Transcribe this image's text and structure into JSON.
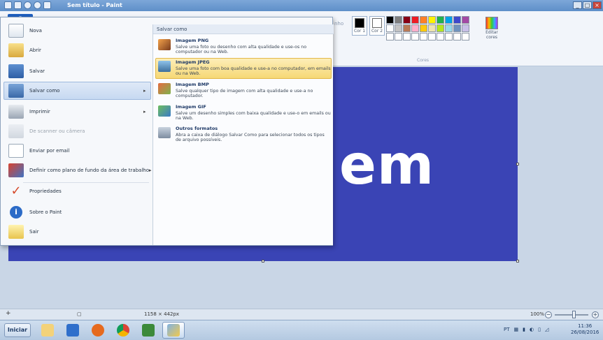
{
  "window": {
    "title": "Sem título - Paint",
    "buttons": [
      "_",
      "□",
      "×"
    ]
  },
  "ribbon": {
    "file_tab_label": "▾",
    "partial_label": "nho",
    "color1_label": "Cor\n1",
    "color2_label": "Cor\n2",
    "edit_colors_label": "Editar cores",
    "group_label": "Cores"
  },
  "colors": {
    "canvas": "#3a44b5",
    "palette": [
      "#000000",
      "#7f7f7f",
      "#880015",
      "#ed1c24",
      "#ff7f27",
      "#fff200",
      "#22b14c",
      "#00a2e8",
      "#3f48cc",
      "#a349a4",
      "#ffffff",
      "#c3c3c3",
      "#b97a57",
      "#ffaec9",
      "#ffc90e",
      "#efe4b0",
      "#b5e61d",
      "#99d9ea",
      "#7092be",
      "#c8bfe7",
      "#ffffff",
      "#ffffff",
      "#ffffff",
      "#ffffff",
      "#ffffff",
      "#ffffff",
      "#ffffff",
      "#ffffff",
      "#ffffff",
      "#ffffff"
    ]
  },
  "canvas": {
    "text": "em"
  },
  "file_menu": {
    "items": [
      {
        "label": "Nova",
        "icon": "new-document-icon"
      },
      {
        "label": "Abrir",
        "icon": "open-folder-icon"
      },
      {
        "label": "Salvar",
        "icon": "save-disk-icon"
      },
      {
        "label": "Salvar como",
        "icon": "save-as-icon",
        "arrow": "▸"
      },
      {
        "label": "Imprimir",
        "icon": "printer-icon",
        "arrow": "▸"
      },
      {
        "label": "De scanner ou câmera",
        "icon": "scanner-icon"
      },
      {
        "label": "Enviar por email",
        "icon": "email-icon"
      },
      {
        "label": "Definir como plano de fundo da área de trabalho",
        "icon": "desktop-background-icon",
        "arrow": "▸"
      },
      {
        "label": "Propriedades",
        "icon": "checkmark-icon"
      },
      {
        "label": "Sobre o Paint",
        "icon": "info-icon"
      },
      {
        "label": "Sair",
        "icon": "exit-icon"
      }
    ],
    "submenu": {
      "title": "Salvar como",
      "items": [
        {
          "title": "Imagem PNG",
          "desc": "Salve uma foto ou desenho com alta qualidade e use-os no computador ou na Web."
        },
        {
          "title": "Imagem JPEG",
          "desc": "Salve uma foto com boa qualidade e use-a no computador, em emails ou na Web."
        },
        {
          "title": "Imagem BMP",
          "desc": "Salve qualquer tipo de imagem com alta qualidade e use-a no computador."
        },
        {
          "title": "Imagem GIF",
          "desc": "Salve um desenho simples com baixa qualidade e use-o em emails ou na Web."
        },
        {
          "title": "Outros formatos",
          "desc": "Abra a caixa de diálogo Salvar Como para selecionar todos os tipos de arquivo possíveis."
        }
      ]
    }
  },
  "statusbar": {
    "add_icon": "+",
    "dimensions": "1158 × 442px",
    "zoom": "100%",
    "zoom_out": "−",
    "zoom_in": "+"
  },
  "taskbar": {
    "start_label": "Iniciar",
    "language": "PT",
    "time": "11:36",
    "date": "26/08/2016"
  }
}
